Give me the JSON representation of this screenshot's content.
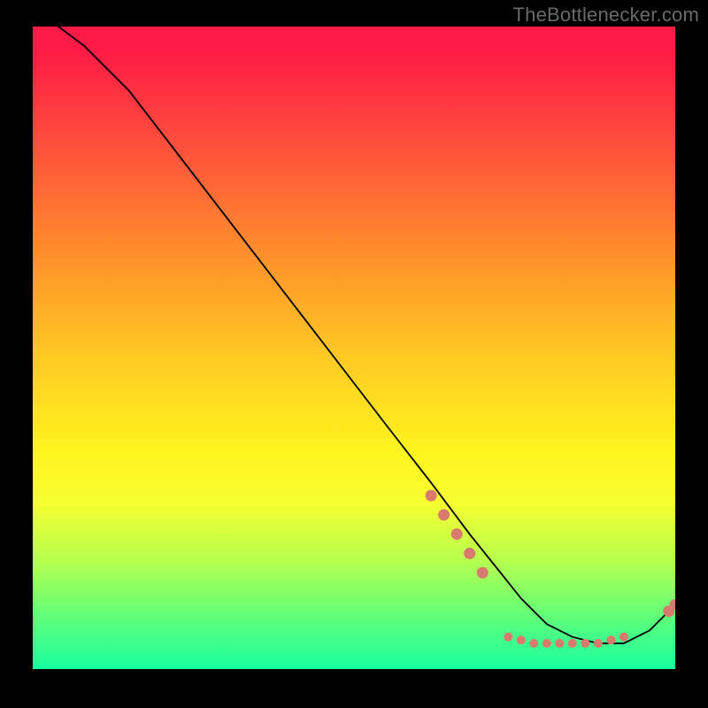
{
  "attribution": "TheBottlenecker.com",
  "chart_data": {
    "type": "line",
    "title": "",
    "xlabel": "",
    "ylabel": "",
    "xlim": [
      0,
      100
    ],
    "ylim": [
      0,
      100
    ],
    "curve": {
      "x": [
        4,
        8,
        15,
        25,
        35,
        45,
        55,
        62,
        68,
        72,
        76,
        80,
        84,
        88,
        92,
        96,
        100
      ],
      "y": [
        100,
        97,
        90,
        77,
        64,
        51,
        38,
        29,
        21,
        16,
        11,
        7,
        5,
        4,
        4,
        6,
        10
      ]
    },
    "markers_lower": {
      "x": [
        74,
        76,
        78,
        80,
        82,
        84,
        86,
        88,
        90,
        92
      ],
      "y": [
        5.0,
        4.5,
        4.0,
        4.0,
        4.0,
        4.0,
        4.0,
        4.0,
        4.5,
        5.0
      ]
    },
    "markers_upper": {
      "x": [
        62,
        64,
        66,
        68,
        70
      ],
      "y": [
        27,
        24,
        21,
        18,
        15
      ]
    },
    "markers_end": {
      "x": [
        99,
        100
      ],
      "y": [
        9,
        10
      ]
    },
    "marker_color": "#d97a6f",
    "curve_color": "#000000"
  }
}
